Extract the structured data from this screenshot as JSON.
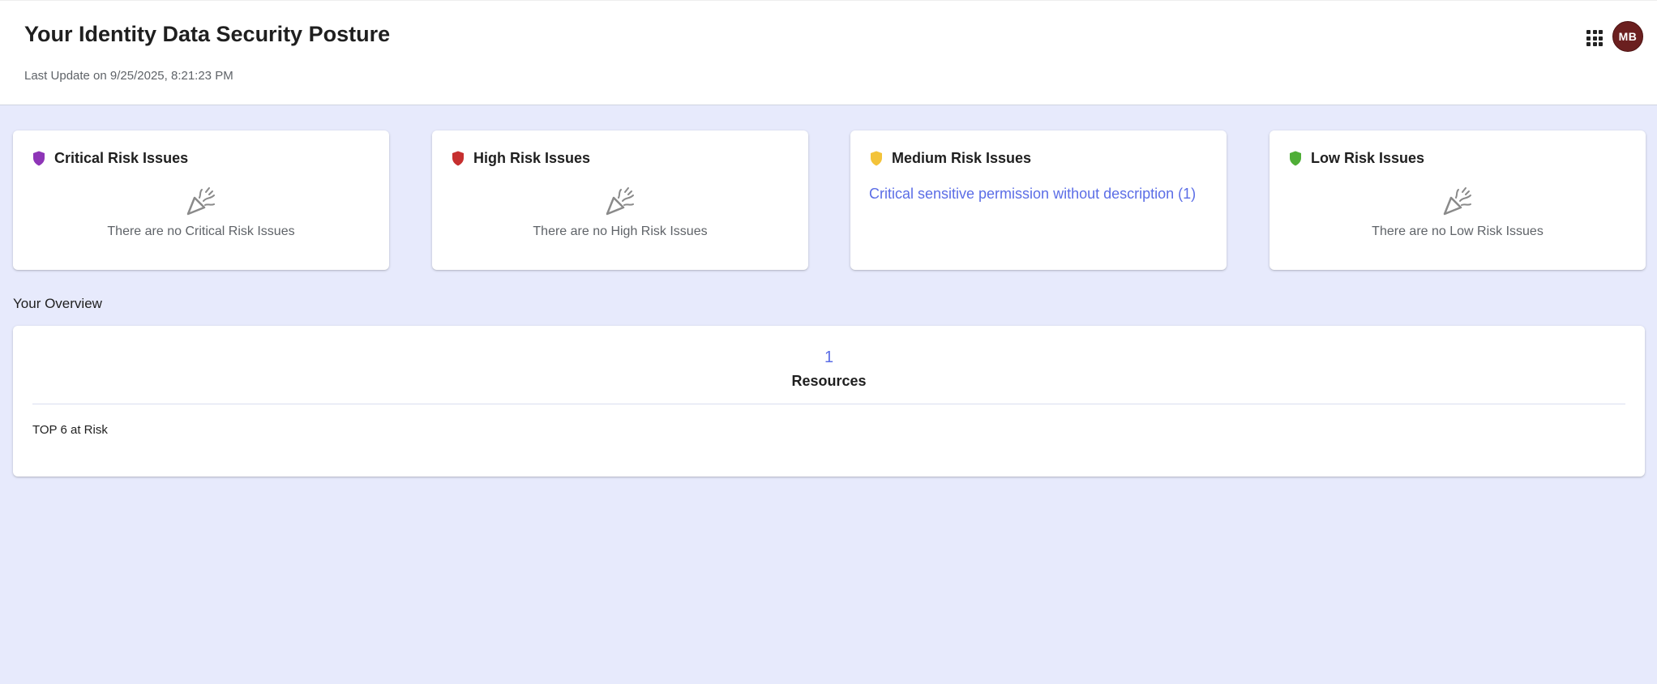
{
  "header": {
    "title": "Your Identity Data Security Posture",
    "last_update": "Last Update on 9/25/2025, 8:21:23 PM",
    "apps_icon": "apps-grid-icon",
    "avatar_initials": "MB",
    "avatar_color": "#6b1f1f"
  },
  "risk_cards": [
    {
      "title": "Critical Risk Issues",
      "shield_color": "#8e35b7",
      "icon": "party-popper-icon",
      "empty_text": "There are no Critical Risk Issues"
    },
    {
      "title": "High Risk Issues",
      "shield_color": "#c62f2f",
      "icon": "party-popper-icon",
      "empty_text": "There are no High Risk Issues"
    },
    {
      "title": "Medium Risk Issues",
      "shield_color": "#f3c33a",
      "issue_link": "Critical sensitive permission without description (1)"
    },
    {
      "title": "Low Risk Issues",
      "shield_color": "#4fae37",
      "icon": "party-popper-icon",
      "empty_text": "There are no Low Risk Issues"
    }
  ],
  "overview": {
    "heading": "Your Overview",
    "resource_count": "1",
    "resource_label": "Resources",
    "top_at_risk_label": "TOP 6 at Risk"
  },
  "colors": {
    "background": "#e7eafc",
    "link": "#5b6de6"
  }
}
